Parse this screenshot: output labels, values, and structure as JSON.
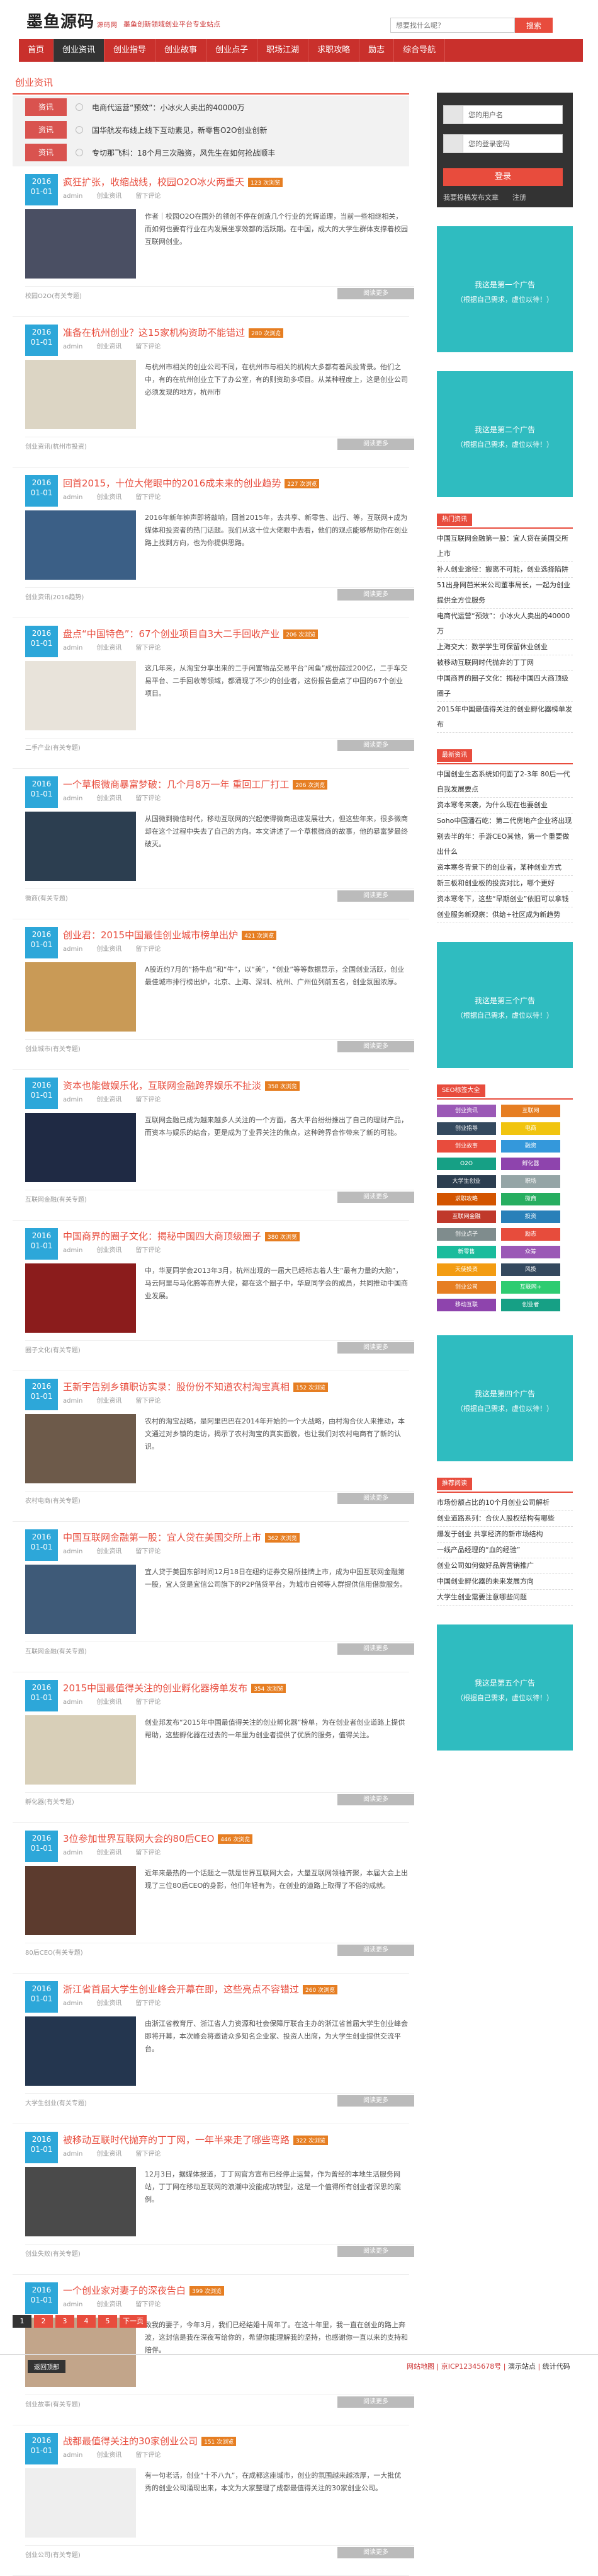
{
  "header": {
    "logo": "墨鱼源码",
    "logo_sub": "源码网",
    "slogan": "墨鱼创新领域创业平台专业站点",
    "search_placeholder": "想要找什么呢？",
    "search_button": "搜索"
  },
  "nav": [
    "首页",
    "创业资讯",
    "创业指导",
    "创业故事",
    "创业点子",
    "职场江湖",
    "求职攻略",
    "励志",
    "综合导航"
  ],
  "section_title": "创业资讯",
  "notices": [
    {
      "tag": "资讯",
      "text": "电商代运营“预效”：小冰火人卖出的40000万"
    },
    {
      "tag": "资讯",
      "text": "国华航发布线上线下互动素见，新零售O2O创业创新"
    },
    {
      "tag": "资讯",
      "text": "专切那飞科：18个月三次融资，风先生在如何抢战顺丰"
    }
  ],
  "posts": [
    {
      "year": "2016",
      "day": "01-01",
      "title": "疯狂扩张，收缩战线，校园O2O冰火两重天",
      "hot": "123 次浏览",
      "author": "admin",
      "cat": "创业资讯",
      "comment": "留下评论",
      "excerpt": "作者｜校园O2O在国外的领创不停在创造几个行业的光辉道理，当前一些相继相关，而如何也要有行业在内发展坐享效都的活跃期。在中国，成大的大学生群体支撑着校园互联网创业。",
      "footer_cat": "校园O2O(有关专题)",
      "more": "阅读更多",
      "thumb": "#4a4f63"
    },
    {
      "year": "2016",
      "day": "01-01",
      "title": "准备在杭州创业？这15家机构资助不能错过",
      "hot": "280 次浏览",
      "author": "admin",
      "cat": "创业资讯",
      "comment": "留下评论",
      "excerpt": "与杭州市相关的创业公司不同，在杭州市与相关的机构大多都有着风投背景。他们之中，有的在杭州创业立下了办公室，有的则资助多项目。从某种程度上，这是创业公司必须发现的地方，杭州市",
      "footer_cat": "创业资讯(杭州市投资)",
      "more": "阅读更多",
      "thumb": "#dcd5c4"
    },
    {
      "year": "2016",
      "day": "01-01",
      "title": "回首2015，十位大佬眼中的2016成未来的创业趋势",
      "hot": "227 次浏览",
      "author": "admin",
      "cat": "创业资讯",
      "comment": "留下评论",
      "excerpt": "2016年新年钟声即将敲响，回首2015年，去共享、新零售、出行、等，互联网+成为媒体和投资者的热门话题。我们从这十位大佬眼中去看，他们的观点能够帮助你在创业路上找到方向，也为你提供思路。",
      "footer_cat": "创业资讯(2016趋势)",
      "more": "阅读更多",
      "thumb": "#3b5f86"
    },
    {
      "year": "2016",
      "day": "01-01",
      "title": "盘点“中国特色”：67个创业项目自3大二手回收产业",
      "hot": "206 次浏览",
      "author": "admin",
      "cat": "创业资讯",
      "comment": "留下评论",
      "excerpt": "这几年来，从淘宝分享出来的二手闲置物品交易平台“闲鱼”成份超过200亿，二手车交易平台、二手回收等领域，都涌现了不少的创业者，这份报告盘点了中国的67个创业项目。",
      "footer_cat": "二手产业(有关专题)",
      "more": "阅读更多",
      "thumb": "#e8e3da"
    },
    {
      "year": "2016",
      "day": "01-01",
      "title": "一个草根微商暴富梦破：几个月8万一年 重回工厂打工",
      "hot": "206 次浏览",
      "author": "admin",
      "cat": "创业资讯",
      "comment": "留下评论",
      "excerpt": "从国微到微信时代，移动互联网的兴起使得微商迅速发展壮大，但这些年来，很多微商却在这个过程中失去了自己的方向。本文讲述了一个草根微商的故事，他的暴富梦最终破灭。",
      "footer_cat": "微商(有关专题)",
      "more": "阅读更多",
      "thumb": "#2c3e50"
    },
    {
      "year": "2016",
      "day": "01-01",
      "title": "创业君：2015中国最佳创业城市榜单出炉",
      "hot": "421 次浏览",
      "author": "admin",
      "cat": "创业资讯",
      "comment": "留下评论",
      "excerpt": "A股近约7月的“扬牛启”和“牛”，以“美”，“创业”等等数据显示，全国创业活跃，创业最佳城市排行榜出炉，北京、上海、深圳、杭州、广州位列前五名，创业氛围浓厚。",
      "footer_cat": "创业城市(有关专题)",
      "more": "阅读更多",
      "thumb": "#c99a56"
    },
    {
      "year": "2016",
      "day": "01-01",
      "title": "资本也能做娱乐化，互联网金融跨界娱乐不扯淡",
      "hot": "358 次浏览",
      "author": "admin",
      "cat": "创业资讯",
      "comment": "留下评论",
      "excerpt": "互联网金融已成为越来越多人关注的一个方面，各大平台纷纷推出了自己的理财产品，而资本与娱乐的结合，更是成为了业界关注的焦点，这种跨界合作带来了新的可能。",
      "footer_cat": "互联网金融(有关专题)",
      "more": "阅读更多",
      "thumb": "#1f2a44"
    },
    {
      "year": "2016",
      "day": "01-01",
      "title": "中国商界的圈子文化：揭秘中国四大商顶级圈子",
      "hot": "380 次浏览",
      "author": "admin",
      "cat": "创业资讯",
      "comment": "留下评论",
      "excerpt": "中，华夏同学会2013年3月，杭州出现的一届大已经标志着人生“最有力量的大脑”，马云阿里与马化腾等商界大佬，都在这个圈子中，华夏同学会的成员，共同推动中国商业发展。",
      "footer_cat": "圈子文化(有关专题)",
      "more": "阅读更多",
      "thumb": "#8b1c1c"
    },
    {
      "year": "2016",
      "day": "01-01",
      "title": "王新宇告别乡镇职访实录：股份份不知道农村淘宝真相",
      "hot": "152 次浏览",
      "author": "admin",
      "cat": "创业资讯",
      "comment": "留下评论",
      "excerpt": "农村的淘宝战略，是阿里巴巴在2014年开始的一个大战略，由村淘合伙人来推动，本文通过对乡镇的走访，揭示了农村淘宝的真实面貌，也让我们对农村电商有了新的认识。",
      "footer_cat": "农村电商(有关专题)",
      "more": "阅读更多",
      "thumb": "#6d5a4a"
    },
    {
      "year": "2016",
      "day": "01-01",
      "title": "中国互联网金融第一股：宜人贷在美国交所上市",
      "hot": "362 次浏览",
      "author": "admin",
      "cat": "创业资讯",
      "comment": "留下评论",
      "excerpt": "宜人贷于美国东部时间12月18日在纽约证券交易所挂牌上市，成为中国互联网金融第一股，宜人贷是宜信公司旗下的P2P借贷平台，为城市白领等人群提供信用借款服务。",
      "footer_cat": "互联网金融(有关专题)",
      "more": "阅读更多",
      "thumb": "#3e5a78"
    },
    {
      "year": "2016",
      "day": "01-01",
      "title": "2015中国最值得关注的创业孵化器榜单发布",
      "hot": "354 次浏览",
      "author": "admin",
      "cat": "创业资讯",
      "comment": "留下评论",
      "excerpt": "创业邦发布“2015年中国最值得关注的创业孵化器”榜单，为在创业者创业道路上提供帮助，这些孵化器在过去的一年里为创业者提供了优质的服务，值得关注。",
      "footer_cat": "孵化器(有关专题)",
      "more": "阅读更多",
      "thumb": "#d8cfb8"
    },
    {
      "year": "2016",
      "day": "01-01",
      "title": "3位参加世界互联网大会的80后CEO",
      "hot": "446 次浏览",
      "author": "admin",
      "cat": "创业资讯",
      "comment": "留下评论",
      "excerpt": "近年来最热的一个话题之一就是世界互联网大会，大量互联网领袖齐聚，本届大会上出现了三位80后CEO的身影，他们年轻有为，在创业的道路上取得了不俗的成就。",
      "footer_cat": "80后CEO(有关专题)",
      "more": "阅读更多",
      "thumb": "#5c3b2e"
    },
    {
      "year": "2016",
      "day": "01-01",
      "title": "浙江省首届大学生创业峰会开幕在即，这些亮点不容错过",
      "hot": "260 次浏览",
      "author": "admin",
      "cat": "创业资讯",
      "comment": "留下评论",
      "excerpt": "由浙江省教育厅、浙江省人力资源和社会保障厅联合主办的浙江省首届大学生创业峰会即将开幕，本次峰会将邀请众多知名企业家、投资人出席，为大学生创业提供交流平台。",
      "footer_cat": "大学生创业(有关专题)",
      "more": "阅读更多",
      "thumb": "#24364f"
    },
    {
      "year": "2016",
      "day": "01-01",
      "title": "被移动互联时代抛弃的丁丁网，一年半来走了哪些弯路",
      "hot": "322 次浏览",
      "author": "admin",
      "cat": "创业资讯",
      "comment": "留下评论",
      "excerpt": "12月3日，据媒体报道，丁丁网官方宣布已经停止运营，作为曾经的本地生活服务网站，丁丁网在移动互联网的浪潮中没能成功转型，这是一个值得所有创业者深思的案例。",
      "footer_cat": "创业失败(有关专题)",
      "more": "阅读更多",
      "thumb": "#4a4a4a"
    },
    {
      "year": "2016",
      "day": "01-01",
      "title": "一个创业家对妻子的深夜告白",
      "hot": "399 次浏览",
      "author": "admin",
      "cat": "创业资讯",
      "comment": "留下评论",
      "excerpt": "致我的妻子，今年3月，我们已经结婚十周年了。在这十年里，我一直在创业的路上奔波，这封信是我在深夜写给你的，希望你能理解我的坚持，也感谢你一直以来的支持和陪伴。",
      "footer_cat": "创业故事(有关专题)",
      "more": "阅读更多",
      "thumb": "#c2a58a"
    },
    {
      "year": "2016",
      "day": "01-01",
      "title": "战都最值得关注的30家创业公司",
      "hot": "151 次浏览",
      "author": "admin",
      "cat": "创业资讯",
      "comment": "留下评论",
      "excerpt": "有一句老话，创业“十不八九”，在成都这座城市，创业的氛围越来越浓厚，一大批优秀的创业公司涌现出来，本文为大家整理了成都最值得关注的30家创业公司。",
      "footer_cat": "创业公司(有关专题)",
      "more": "阅读更多",
      "thumb": "#eeeeee"
    }
  ],
  "pager": [
    "1",
    "2",
    "3",
    "4",
    "5",
    "下一页"
  ],
  "sidebar": {
    "login": {
      "user_placeholder": "您的用户名",
      "pass_placeholder": "您的登录密码",
      "login_button": "登录",
      "register_link": "我要投稿发布文章",
      "reg_link": "注册"
    },
    "ads": [
      {
        "l1": "我这是第一个广告",
        "l2": "（根据自己需求，虚位以待！）"
      },
      {
        "l1": "我这是第二个广告",
        "l2": "（根据自己需求，虚位以待！）"
      },
      {
        "l1": "我这是第三个广告",
        "l2": "（根据自己需求，虚位以待！）"
      },
      {
        "l1": "我这是第四个广告",
        "l2": "（根据自己需求，虚位以待！）"
      },
      {
        "l1": "我这是第五个广告",
        "l2": "（根据自己需求，虚位以待！）"
      }
    ],
    "hot_title": "热门资讯",
    "hot_list": [
      "中国互联网金融第一股：宜人贷在美国交所上市",
      "补人创业途径：搬离不可能，创业选择陷阱",
      "51出身网芭米米公司董事局长，一起为创业提供全方位服务",
      "电商代运营“预效”：小冰火人卖出的40000万",
      "上海交大：数学学生可保留休业创业",
      "被移动互联网时代抛弃的丁丁网",
      "中国商界的圈子文化：揭秘中国四大商顶级圈子",
      "2015年中国最值得关注的创业孵化器榜单发布"
    ],
    "new_title": "最新资讯",
    "new_list": [
      "中国创业生态系统如何面了2-3年 80后一代自我发展要点",
      "资本寒冬来袭，为什么现在也要创业",
      "Soho中国潘石屹：第二代房地产企业将出现",
      "别去半的年：手游CEO其他，第一个重要做出什么",
      "资本寒冬背景下的创业者，某种创业方式",
      "新三板和创业板的投资对比，哪个更好",
      "资本寒冬下，这些“早期创业”依旧可以拿钱",
      "创业服务新观察：供给+社区成为新趋势"
    ],
    "tags_title": "SEO标签大全",
    "tags": [
      {
        "t": "创业资讯",
        "c": "#9b59b6"
      },
      {
        "t": "互联网",
        "c": "#e67e22"
      },
      {
        "t": "创业指导",
        "c": "#34495e"
      },
      {
        "t": "电商",
        "c": "#f1c40f"
      },
      {
        "t": "创业故事",
        "c": "#e84c3d"
      },
      {
        "t": "融资",
        "c": "#3498db"
      },
      {
        "t": "O2O",
        "c": "#16a085"
      },
      {
        "t": "孵化器",
        "c": "#8e44ad"
      },
      {
        "t": "大学生创业",
        "c": "#2c3e50"
      },
      {
        "t": "职场",
        "c": "#95a5a6"
      },
      {
        "t": "求职攻略",
        "c": "#d35400"
      },
      {
        "t": "微商",
        "c": "#27ae60"
      },
      {
        "t": "互联网金融",
        "c": "#c0392b"
      },
      {
        "t": "投资",
        "c": "#2980b9"
      },
      {
        "t": "创业点子",
        "c": "#7f8c8d"
      },
      {
        "t": "励志",
        "c": "#e74c3c"
      },
      {
        "t": "新零售",
        "c": "#1abc9c"
      },
      {
        "t": "众筹",
        "c": "#9b59b6"
      },
      {
        "t": "天使投资",
        "c": "#f39c12"
      },
      {
        "t": "风投",
        "c": "#34495e"
      },
      {
        "t": "创业公司",
        "c": "#e67e22"
      },
      {
        "t": "互联网+",
        "c": "#2ecc71"
      },
      {
        "t": "移动互联",
        "c": "#8e44ad"
      },
      {
        "t": "创业者",
        "c": "#16a085"
      }
    ],
    "rec_title": "推荐阅读",
    "rec_list": [
      "市场份额占比的10个月创业公司解析",
      "创业道路系列：合伙人股权结构有哪些",
      "爆发于创业 共享经济的新市场结构",
      "一线产品经理的“血的经验”",
      "创业公司如何做好品牌营销推广",
      "中国创业孵化器的未来发展方向",
      "大学生创业需要注意哪些问题"
    ]
  },
  "footer": {
    "back_top": "返回顶部",
    "right": "网站地图",
    "icp": "京ICP12345678号",
    "copy": "演示站点",
    "stat": "统计代码"
  }
}
